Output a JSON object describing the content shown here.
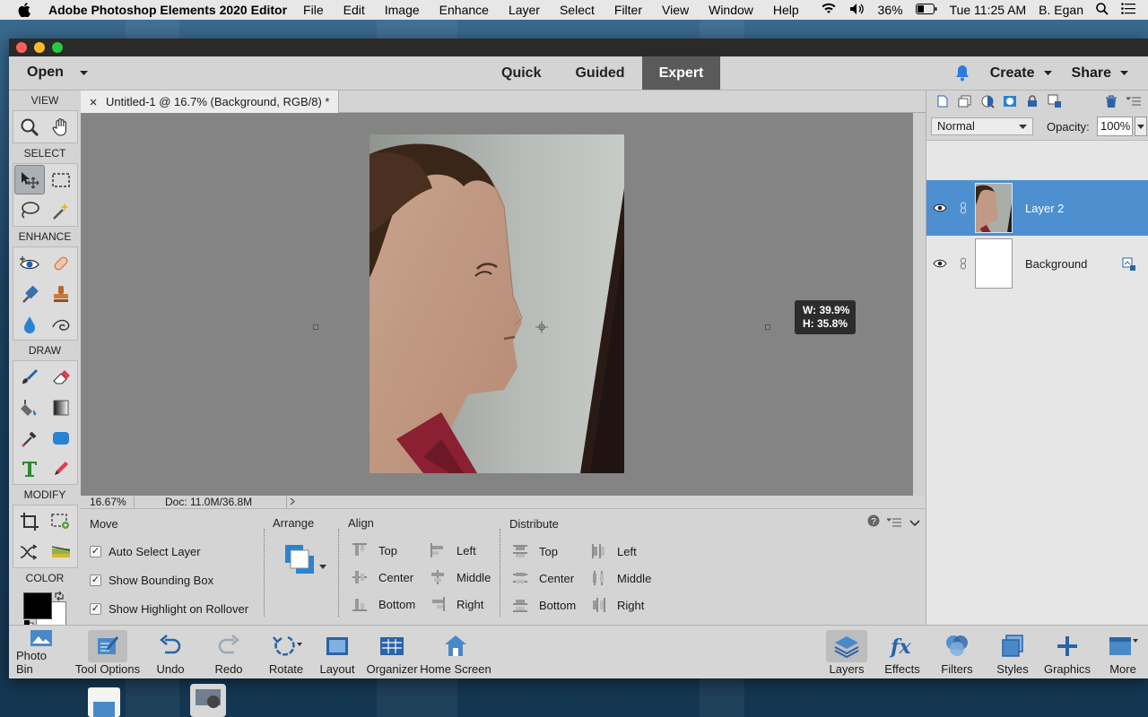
{
  "menubar": {
    "app_name": "Adobe Photoshop Elements 2020 Editor",
    "items": [
      "File",
      "Edit",
      "Image",
      "Enhance",
      "Layer",
      "Select",
      "Filter",
      "View",
      "Window",
      "Help"
    ],
    "battery": "36%",
    "clock": "Tue 11:25 AM",
    "user": "B. Egan"
  },
  "topbar": {
    "open_label": "Open",
    "modes": [
      {
        "label": "Quick",
        "active": false
      },
      {
        "label": "Guided",
        "active": false
      },
      {
        "label": "Expert",
        "active": true
      }
    ],
    "create_label": "Create",
    "share_label": "Share"
  },
  "toolbox": {
    "sections": [
      "VIEW",
      "SELECT",
      "ENHANCE",
      "DRAW",
      "MODIFY",
      "COLOR"
    ]
  },
  "document": {
    "tab_title": "Untitled-1 @ 16.7% (Background, RGB/8) *",
    "transform_w": "W: 39.9%",
    "transform_h": "H: 35.8%",
    "zoom": "16.67%",
    "doc_size": "Doc: 11.0M/36.8M"
  },
  "tool_options": {
    "tool_name": "Move",
    "checkboxes": [
      {
        "label": "Auto Select Layer",
        "checked": true
      },
      {
        "label": "Show Bounding Box",
        "checked": true
      },
      {
        "label": "Show Highlight on Rollover",
        "checked": true
      }
    ],
    "arrange_label": "Arrange",
    "align_label": "Align",
    "align_items": [
      "Top",
      "Center",
      "Bottom",
      "Left",
      "Middle",
      "Right"
    ],
    "distribute_label": "Distribute",
    "distribute_items": [
      "Top",
      "Center",
      "Bottom",
      "Left",
      "Middle",
      "Right"
    ]
  },
  "layers_panel": {
    "blend_mode": "Normal",
    "opacity_label": "Opacity:",
    "opacity_value": "100%",
    "layers": [
      {
        "name": "Layer 2",
        "selected": true
      },
      {
        "name": "Background",
        "selected": false
      }
    ]
  },
  "bottombar": {
    "left": [
      "Photo Bin",
      "Tool Options",
      "Undo",
      "Redo",
      "Rotate",
      "Layout",
      "Organizer",
      "Home Screen"
    ],
    "right": [
      "Layers",
      "Effects",
      "Filters",
      "Styles",
      "Graphics",
      "More"
    ]
  },
  "colors": {
    "accent": "#4e8fd0",
    "active_tab": "#5a5a5a",
    "canvas_bg": "#848484",
    "foreground": "#000000",
    "background": "#ffffff"
  }
}
